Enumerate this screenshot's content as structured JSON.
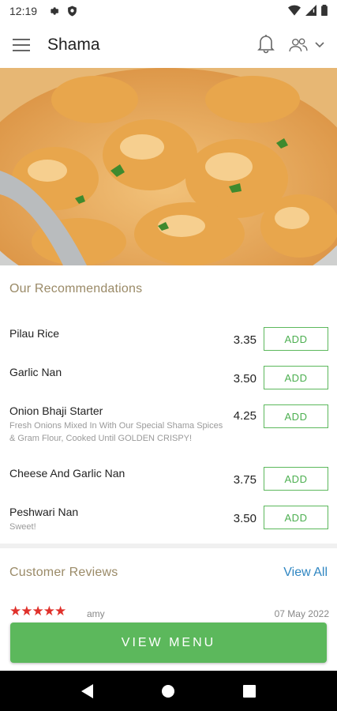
{
  "status_bar": {
    "time": "12:19"
  },
  "app_bar": {
    "title": "Shama"
  },
  "recommendations": {
    "title": "Our Recommendations",
    "items": [
      {
        "name": "Pilau Rice",
        "description": "",
        "price": "3.35",
        "action": "ADD"
      },
      {
        "name": "Garlic Nan",
        "description": "",
        "price": "3.50",
        "action": "ADD"
      },
      {
        "name": "Onion Bhaji Starter",
        "description": "Fresh Onions Mixed In With Our Special Shama Spices & Gram Flour, Cooked Until GOLDEN CRISPY!",
        "price": "4.25",
        "action": "ADD"
      },
      {
        "name": "Cheese And Garlic Nan",
        "description": "",
        "price": "3.75",
        "action": "ADD"
      },
      {
        "name": "Peshwari Nan",
        "description": "Sweet!",
        "price": "3.50",
        "action": "ADD"
      }
    ]
  },
  "reviews": {
    "title": "Customer Reviews",
    "view_all": "View All",
    "first": {
      "stars": "★★★★★",
      "rating": 5,
      "reviewer": "amy",
      "date": "07 May 2022"
    }
  },
  "view_menu_label": "VIEW MENU",
  "colors": {
    "accent_green": "#5cb85c",
    "section_title": "#9a8a67",
    "link_blue": "#2f86c2",
    "star_red": "#e0312b"
  }
}
